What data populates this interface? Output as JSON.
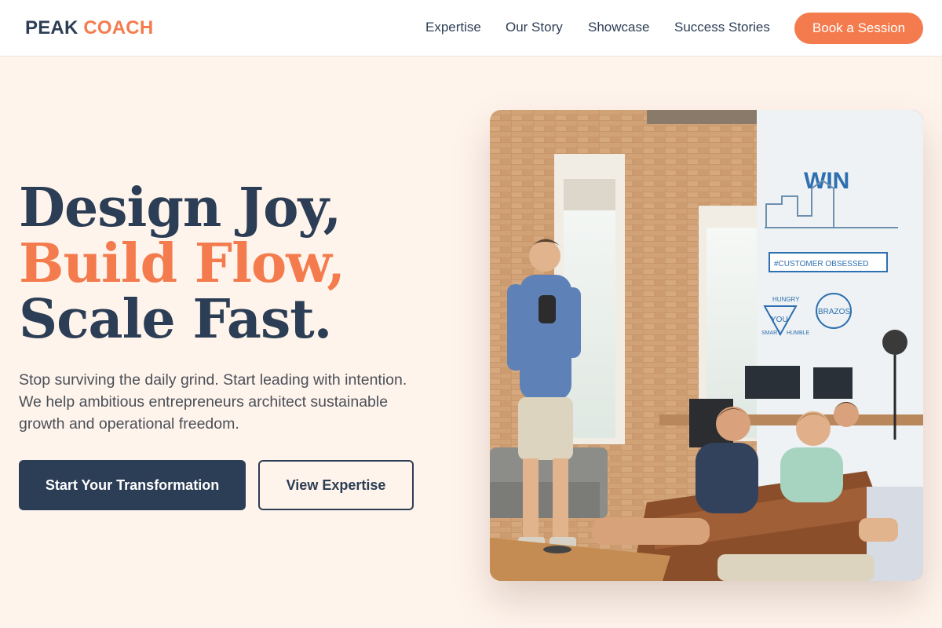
{
  "header": {
    "logo_part1": "PEAK",
    "logo_part2": "COACH",
    "nav": [
      "Expertise",
      "Our Story",
      "Showcase",
      "Success Stories"
    ],
    "cta_label": "Book a Session"
  },
  "hero": {
    "headline_line1": "Design Joy,",
    "headline_line2": "Build Flow,",
    "headline_line3": "Scale Fast.",
    "subtext": "Stop surviving the daily grind. Start leading with intention. We help ambitious entrepreneurs architect sustainable growth and operational freedom.",
    "primary_button": "Start Your Transformation",
    "secondary_button": "View Expertise",
    "image": {
      "wall_text_win": "WIN",
      "wall_text_banner": "#CUSTOMER OBSESSED",
      "wall_text_badge1": "YOU",
      "wall_text_badge2": "BRAZOS",
      "wall_text_tag1": "HUNGRY",
      "wall_text_tag2": "SMART",
      "wall_text_tag3": "HUMBLE"
    }
  },
  "colors": {
    "navy": "#2c3e55",
    "accent": "#f47b4d",
    "page_bg": "#fff4ec"
  }
}
